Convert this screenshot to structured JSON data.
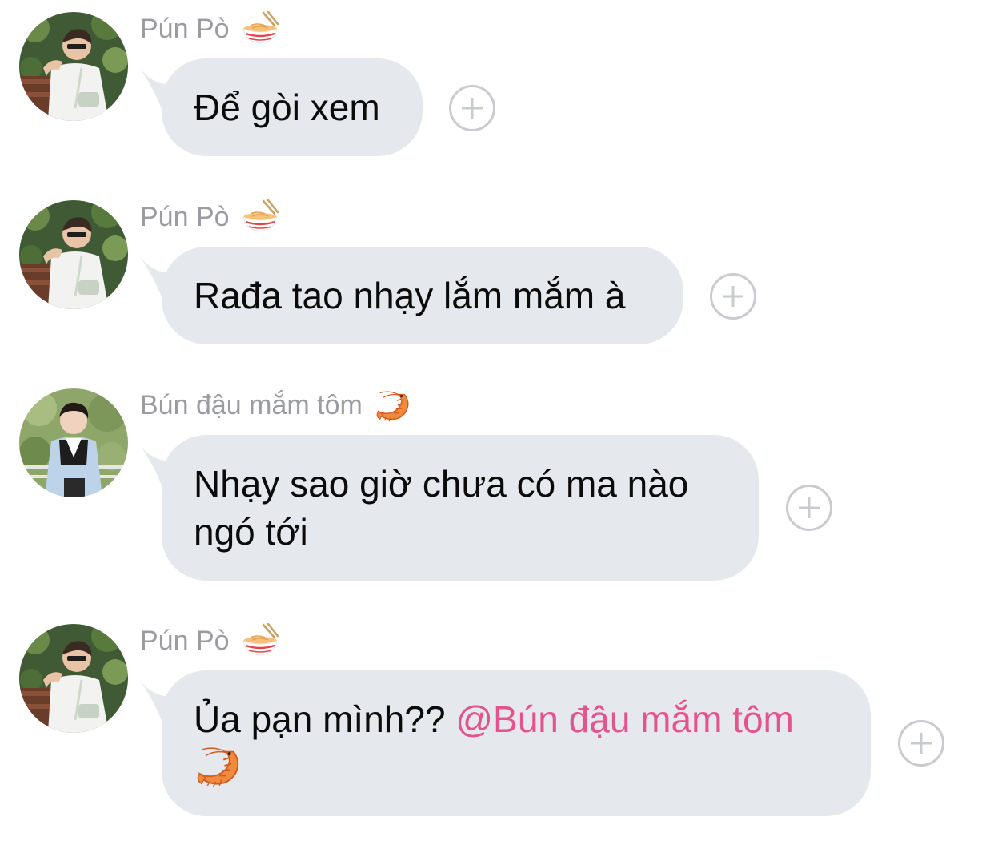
{
  "messages": [
    {
      "sender": "Pún Pò",
      "sender_emoji": "noodle-bowl-icon",
      "text": "Để gòi xem"
    },
    {
      "sender": "Pún Pò",
      "sender_emoji": "noodle-bowl-icon",
      "text": "Rađa tao nhạy lắm mắm à"
    },
    {
      "sender": "Bún đậu mắm tôm",
      "sender_emoji": "shrimp-icon",
      "text_line1": "Nhạy sao giờ chưa có ma nào",
      "text_line2": "ngó tới"
    },
    {
      "sender": "Pún Pò",
      "sender_emoji": "noodle-bowl-icon",
      "text": "Ủa pạn mình??",
      "mention": "@Bún đậu mắm tôm",
      "trailing_emoji": "shrimp-icon"
    }
  ],
  "colors": {
    "bubble": "#e5e8ec",
    "sender": "#9a9ca1",
    "mention": "#e5538d",
    "react_border": "#c9cbcf"
  }
}
